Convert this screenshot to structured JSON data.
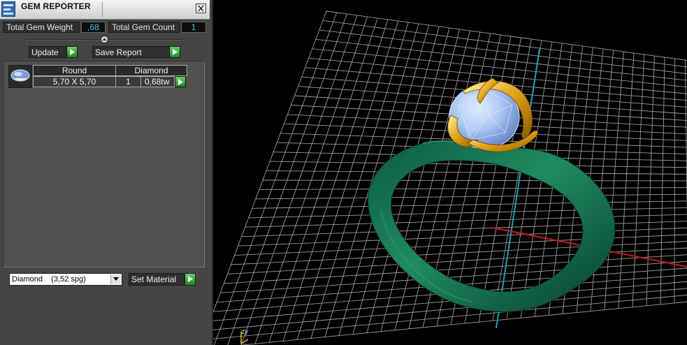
{
  "window": {
    "title": "GEM REPORTER"
  },
  "stats": {
    "total_weight_label": "Total Gem Weight",
    "total_weight_value": ",68",
    "total_count_label": "Total Gem Count",
    "total_count_value": "1"
  },
  "actions": {
    "update_label": "Update",
    "save_report_label": "Save Report"
  },
  "gem_table": {
    "rows": [
      {
        "cut": "Round",
        "material": "Diamond",
        "size": "5,70 X 5,70",
        "count": "1",
        "weight": "0,68tw"
      }
    ]
  },
  "material": {
    "selected": "Diamond    (3,52 spg)",
    "set_label": "Set Material"
  },
  "viewport": {
    "axis_label": "zy"
  },
  "colors": {
    "accent_green": "#2ea82e",
    "value_blue": "#38c0ff",
    "ring_shank": "#0e6a4c",
    "prongs_gold": "#e0a015",
    "gem_blue": "#a9c6f2",
    "x_axis": "#c01818",
    "z_axis": "#1aa0b8"
  },
  "icons": [
    "app-icon",
    "close-icon",
    "collapse-icon",
    "play-icon",
    "gem-thumbnail-icon",
    "chevron-down-icon"
  ]
}
